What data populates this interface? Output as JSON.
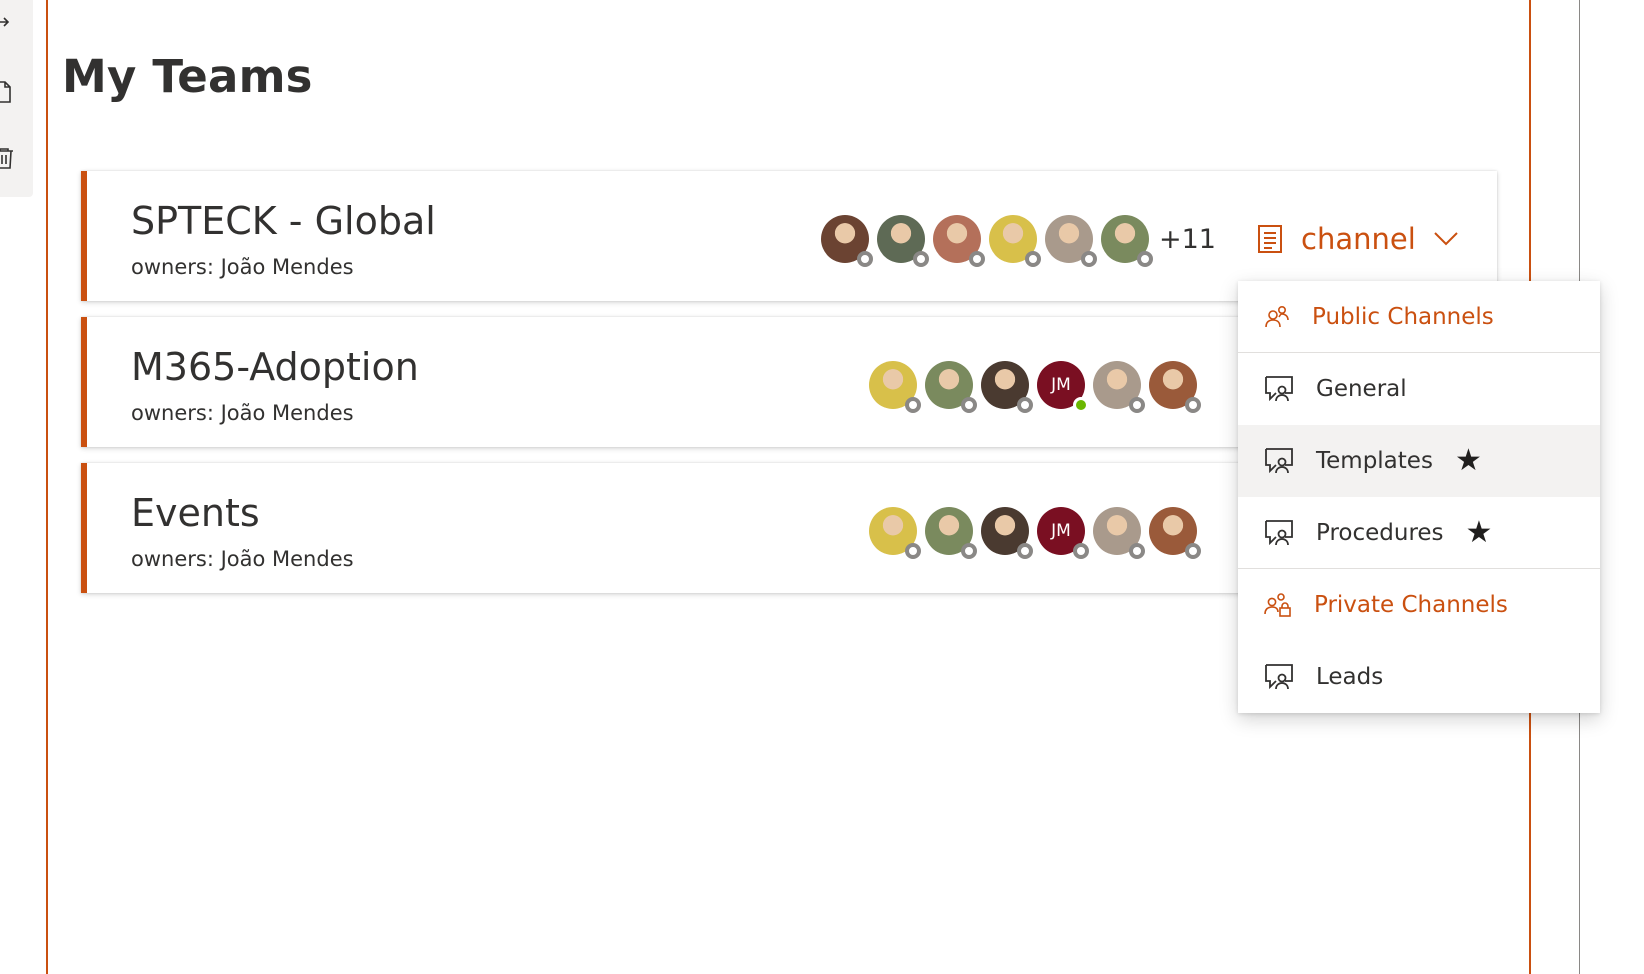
{
  "page": {
    "title": "My Teams"
  },
  "colors": {
    "accent": "#ca5010",
    "online": "#6bb700",
    "offline": "#8a8886",
    "initials_bg": "#7a0f22"
  },
  "toolbar": {
    "icons": [
      "move-icon",
      "copy-icon",
      "delete-icon"
    ]
  },
  "teams": [
    {
      "name": "SPTECK - Global",
      "owners": "owners: João Mendes",
      "members": [
        {
          "kind": "photo",
          "tone": "#6b4332",
          "presence": "offline"
        },
        {
          "kind": "photo",
          "tone": "#5e6a55",
          "presence": "offline"
        },
        {
          "kind": "photo",
          "tone": "#b4705a",
          "presence": "offline"
        },
        {
          "kind": "photo",
          "tone": "#d8c04a",
          "presence": "offline"
        },
        {
          "kind": "photo",
          "tone": "#a99a8c",
          "presence": "offline"
        },
        {
          "kind": "photo",
          "tone": "#7a8a5e",
          "presence": "offline"
        }
      ],
      "more_count": "+11",
      "channel_label": "channel"
    },
    {
      "name": "M365-Adoption",
      "owners": "owners: João Mendes",
      "members": [
        {
          "kind": "photo",
          "tone": "#d8c04a",
          "presence": "offline"
        },
        {
          "kind": "photo",
          "tone": "#7a8a5e",
          "presence": "offline"
        },
        {
          "kind": "photo",
          "tone": "#4a3a30",
          "presence": "offline"
        },
        {
          "kind": "initials",
          "initials": "JM",
          "presence": "online"
        },
        {
          "kind": "photo",
          "tone": "#a99a8c",
          "presence": "offline"
        },
        {
          "kind": "photo",
          "tone": "#9a5a3a",
          "presence": "offline"
        }
      ]
    },
    {
      "name": "Events",
      "owners": "owners: João Mendes",
      "members": [
        {
          "kind": "photo",
          "tone": "#d8c04a",
          "presence": "offline"
        },
        {
          "kind": "photo",
          "tone": "#7a8a5e",
          "presence": "offline"
        },
        {
          "kind": "photo",
          "tone": "#4a3a30",
          "presence": "offline"
        },
        {
          "kind": "initials",
          "initials": "JM",
          "presence": "offline"
        },
        {
          "kind": "photo",
          "tone": "#a99a8c",
          "presence": "offline"
        },
        {
          "kind": "photo",
          "tone": "#9a5a3a",
          "presence": "offline"
        }
      ]
    }
  ],
  "channel_menu": {
    "public_header": "Public Channels",
    "public": [
      {
        "label": "General",
        "favorite": false
      },
      {
        "label": "Templates",
        "favorite": true
      },
      {
        "label": "Procedures",
        "favorite": true
      }
    ],
    "private_header": "Private Channels",
    "private": [
      {
        "label": "Leads",
        "favorite": false
      }
    ],
    "favorite_glyph": "★"
  }
}
